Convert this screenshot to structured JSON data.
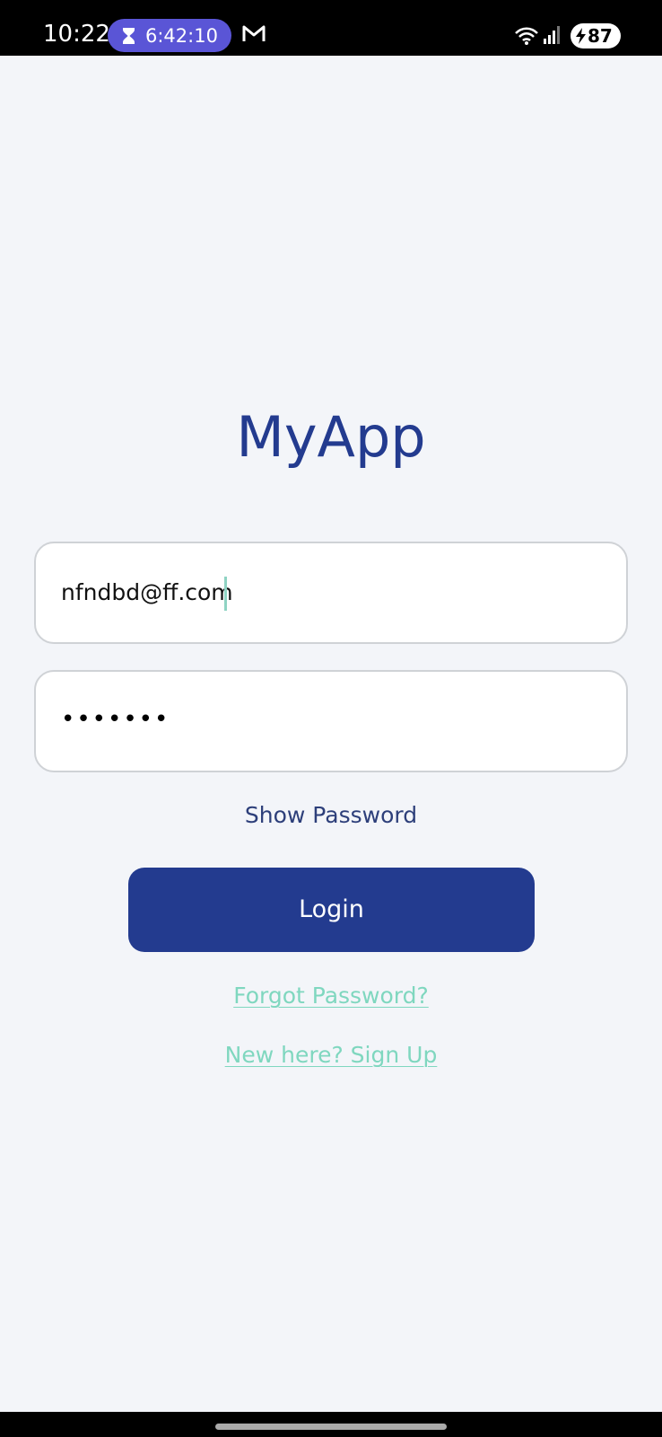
{
  "status_bar": {
    "time": "10:22",
    "timer": "6:42:10",
    "icons": [
      "hourglass-icon",
      "gmail-icon",
      "wifi-icon",
      "signal-icon",
      "battery-icon"
    ],
    "battery_level": "87",
    "timer_pill_color": "#5a55d6"
  },
  "app": {
    "title": "MyApp"
  },
  "form": {
    "email_value": "nfndbd@ff.com",
    "password_mask": "•••••••",
    "show_password_label": "Show Password",
    "login_label": "Login",
    "forgot_password_label": "Forgot Password?",
    "signup_label": "New here? Sign Up"
  },
  "colors": {
    "primary": "#233b8f",
    "link": "#7fd7bf",
    "background": "#f3f5f9",
    "field_border": "#cfd2d6"
  }
}
